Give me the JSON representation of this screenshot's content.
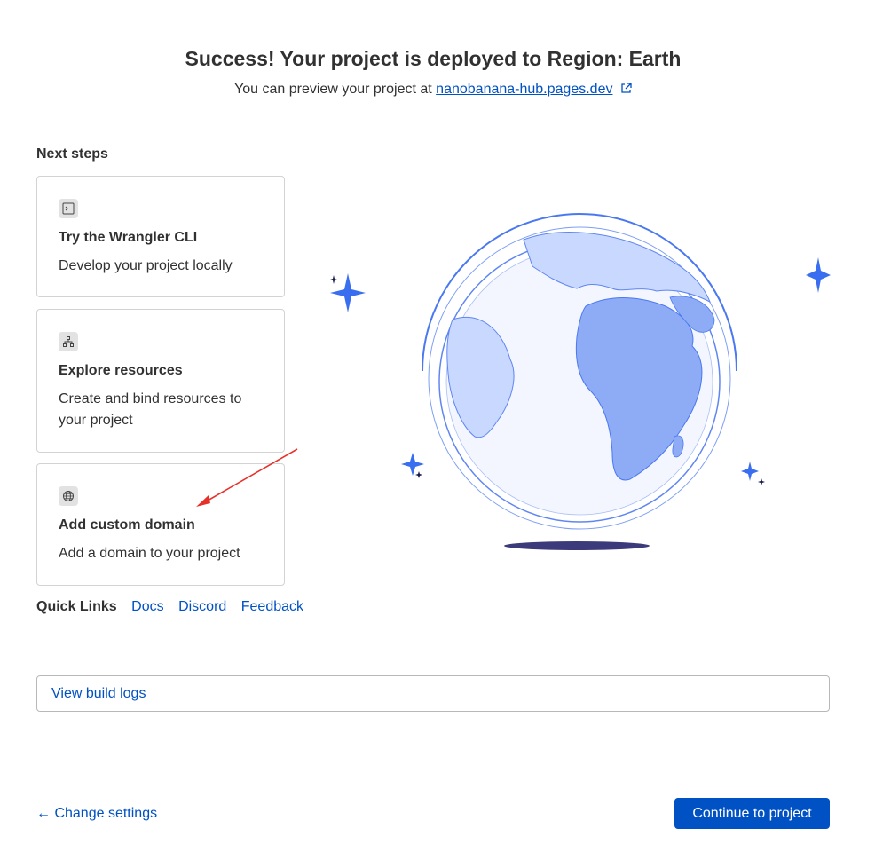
{
  "header": {
    "title": "Success! Your project is deployed to Region: Earth",
    "preview_prefix": "You can preview your project at",
    "preview_link": "nanobanana-hub.pages.dev"
  },
  "next_steps": {
    "heading": "Next steps",
    "cards": [
      {
        "icon": "terminal-icon",
        "title": "Try the Wrangler CLI",
        "description": "Develop your project locally"
      },
      {
        "icon": "sitemap-icon",
        "title": "Explore resources",
        "description": "Create and bind resources to your project"
      },
      {
        "icon": "globe-icon",
        "title": "Add custom domain",
        "description": "Add a domain to your project"
      }
    ]
  },
  "quick_links": {
    "label": "Quick Links",
    "links": [
      "Docs",
      "Discord",
      "Feedback"
    ]
  },
  "build_logs": {
    "label": "View build logs"
  },
  "footer": {
    "back_label": "Change settings",
    "continue_label": "Continue to project"
  },
  "colors": {
    "accent": "#0051c3",
    "globe_light": "#c9d8ff",
    "globe_mid": "#8eabf5",
    "shadow": "#3b3a7a",
    "annotation_arrow": "#e8302a"
  }
}
